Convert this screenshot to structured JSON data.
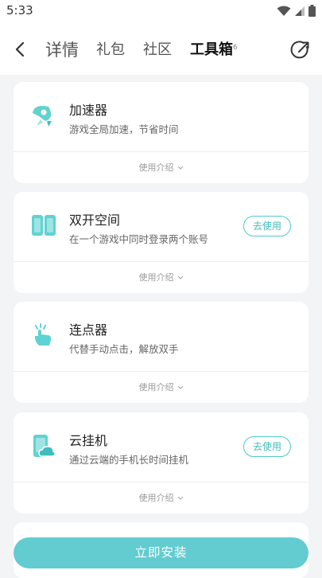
{
  "status_bar": {
    "time": "5:33"
  },
  "nav": {
    "tabs": [
      {
        "label": "详情"
      },
      {
        "label": "礼包"
      },
      {
        "label": "社区"
      },
      {
        "label": "工具箱"
      }
    ],
    "active_badge": "6"
  },
  "tools": [
    {
      "title": "加速器",
      "desc": "游戏全局加速，节省时间",
      "guide": "使用介绍",
      "icon": "rocket-icon"
    },
    {
      "title": "双开空间",
      "desc": "在一个游戏中同时登录两个账号",
      "guide": "使用介绍",
      "action": "去使用",
      "icon": "dual-phone-icon"
    },
    {
      "title": "连点器",
      "desc": "代替手动点击，解放双手",
      "guide": "使用介绍",
      "icon": "tap-hand-icon"
    },
    {
      "title": "云挂机",
      "desc": "通过云端的手机长时间挂机",
      "guide": "使用介绍",
      "action": "去使用",
      "icon": "cloud-phone-icon"
    }
  ],
  "install": {
    "label": "立即安装"
  },
  "colors": {
    "accent": "#4fcbc9",
    "install_bg": "#62ccd0",
    "page_bg": "#f3f4f6"
  }
}
